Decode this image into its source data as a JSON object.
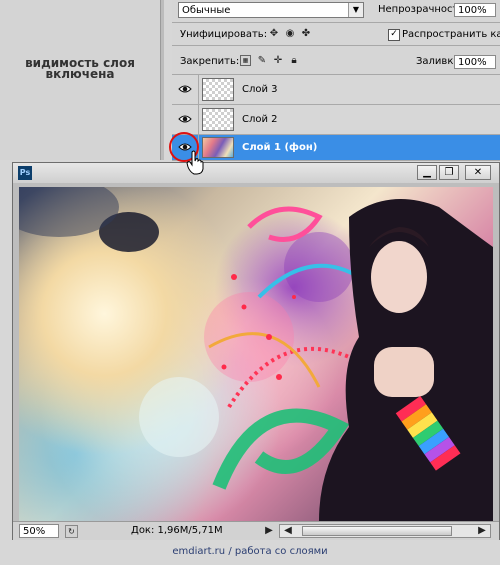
{
  "caption": {
    "text": "видимость слоя включена"
  },
  "layers_panel": {
    "blend_mode": "Обычные",
    "opacity_label": "Непрозрачность:",
    "opacity_value": "100%",
    "unify_label": "Унифицировать:",
    "propagate_label": "Распространить кад",
    "propagate_checked": true,
    "lock_label": "Закрепить:",
    "fill_label": "Заливка:",
    "fill_value": "100%",
    "layers": [
      {
        "name": "Слой 3",
        "visible": true,
        "active": false,
        "thumb": "checker"
      },
      {
        "name": "Слой 2",
        "visible": true,
        "active": false,
        "thumb": "checker"
      },
      {
        "name": "Слой 1 (фон)",
        "visible": true,
        "active": true,
        "thumb": "colorful"
      }
    ]
  },
  "document": {
    "app_icon": "Ps",
    "zoom": "50%",
    "doc_info": "Док: 1,96M/5,71M"
  },
  "footer": {
    "site": "emdiart.ru",
    "separator": "/",
    "topic": "работа со слоями"
  },
  "colors": {
    "active_row": "#3a8ee6",
    "highlight": "#dd1111"
  }
}
